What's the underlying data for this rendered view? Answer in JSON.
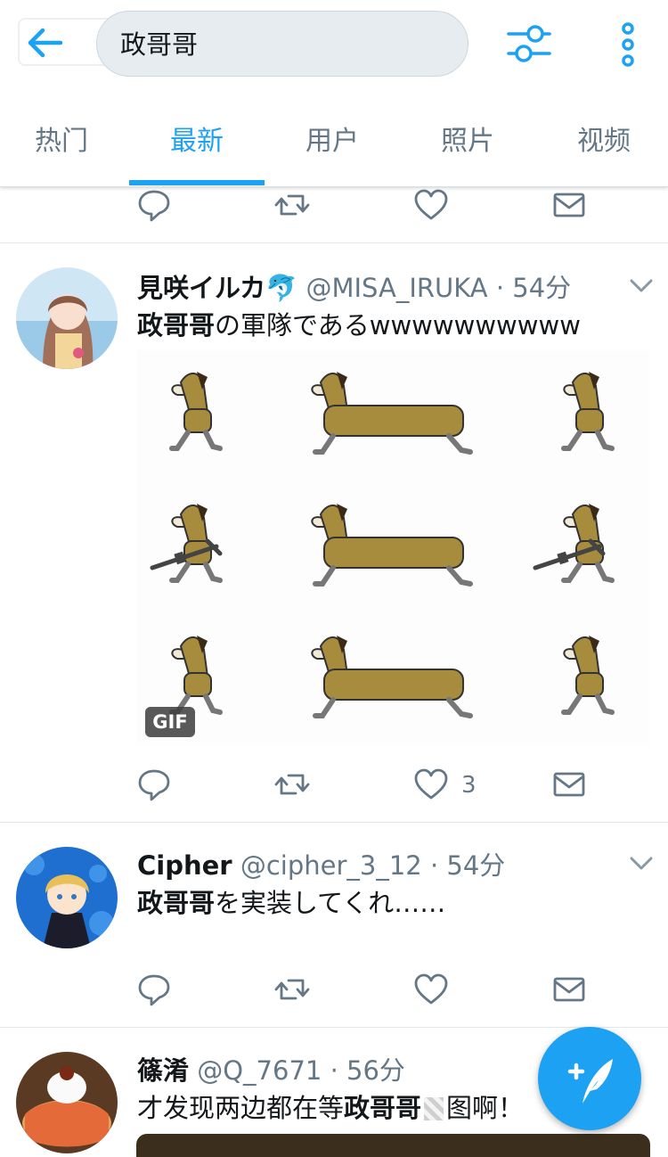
{
  "search": {
    "query": "政哥哥"
  },
  "tabs": [
    {
      "label": "热门"
    },
    {
      "label": "最新"
    },
    {
      "label": "用户"
    },
    {
      "label": "照片"
    },
    {
      "label": "视频"
    }
  ],
  "tweets": [
    {
      "name": "見咲イルカ🐬",
      "handle": "@MISA_IRUKA",
      "time": "· 54分",
      "text_bold": "政哥哥",
      "text_rest": "の軍隊であるwwwwwwwwww",
      "media_badge": "GIF",
      "like_count": "3"
    },
    {
      "name": "Cipher",
      "handle": "@cipher_3_12",
      "time": "· 54分",
      "text_bold": "政哥哥",
      "text_rest": "を実装してくれ……"
    },
    {
      "name": "篠淆",
      "handle": "@Q_7671",
      "time": "· 56分",
      "text_pre": "才发现两边都在等",
      "text_bold": "政哥哥",
      "text_post": "图啊！"
    }
  ],
  "icons": {
    "back": "arrow-left-icon",
    "filter": "sliders-icon",
    "more": "vertical-dots-icon",
    "reply": "reply-icon",
    "retweet": "retweet-icon",
    "like": "heart-icon",
    "message": "envelope-icon",
    "compose": "compose-icon"
  },
  "colors": {
    "accent": "#1da1f2",
    "muted": "#657786",
    "text": "#14171a"
  }
}
